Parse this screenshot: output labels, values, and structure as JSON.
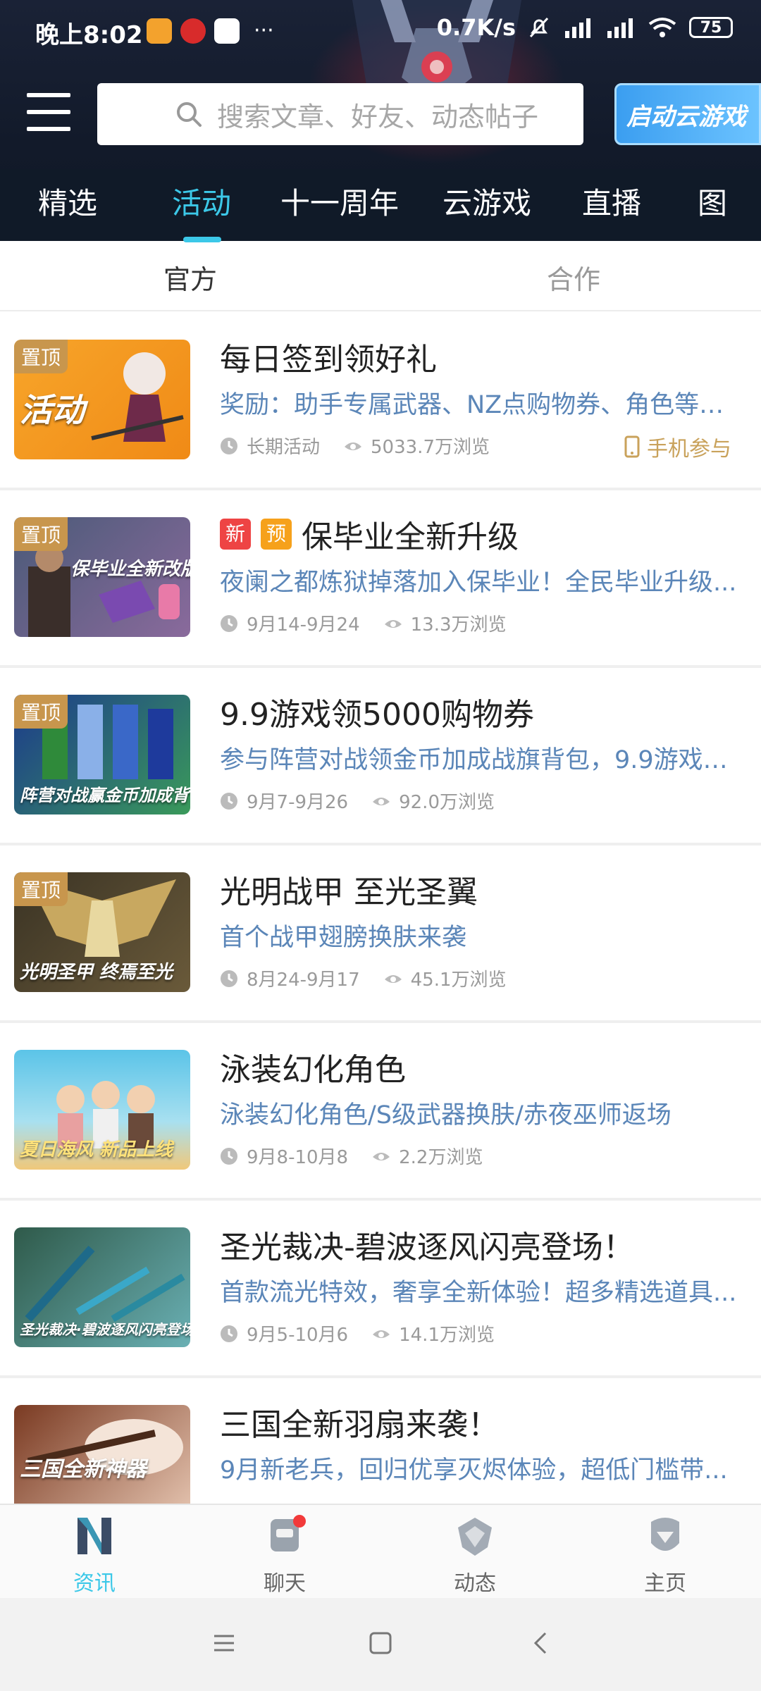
{
  "status_bar": {
    "time": "晚上8:02",
    "net_speed": "0.7K/s",
    "battery": "75"
  },
  "top_bar": {
    "search_placeholder": "搜索文章、好友、动态帖子",
    "cloud_game_button": "启动云游戏"
  },
  "tabs": [
    "精选",
    "活动",
    "十一周年",
    "云游戏",
    "直播",
    "图"
  ],
  "active_tab": "活动",
  "sub_tabs": {
    "official": "官方",
    "cooperation": "合作"
  },
  "activities": [
    {
      "title": "每日签到领好礼",
      "desc": "奖励：助手专属武器、NZ点购物券、角色等超...",
      "period": "长期活动",
      "views": "5033.7万浏览",
      "pinned_label": "置顶",
      "thumb_text": "活动",
      "join_label": "手机参与",
      "colors": [
        "#f7a52a",
        "#f08a16"
      ]
    },
    {
      "title": "保毕业全新升级",
      "desc": "夜阑之都炼狱掉落加入保毕业！全民毕业升级...",
      "period": "9月14-9月24",
      "views": "13.3万浏览",
      "pinned_label": "置顶",
      "tag_new": "新",
      "tag_pre": "预",
      "thumb_text": "保毕业全新改版升级!",
      "colors": [
        "#4a5a78",
        "#8a6a9c"
      ]
    },
    {
      "title": "9.9游戏领5000购物券",
      "desc": "参与阵营对战领金币加成战旗背包，9.9游戏领...",
      "period": "9月7-9月26",
      "views": "92.0万浏览",
      "pinned_label": "置顶",
      "thumb_text": "阵营对战赢金币加成背包",
      "colors": [
        "#1c3a8c",
        "#3a9a5a"
      ]
    },
    {
      "title": "光明战甲 至光圣翼",
      "desc": "首个战甲翅膀换肤来袭",
      "period": "8月24-9月17",
      "views": "45.1万浏览",
      "pinned_label": "置顶",
      "thumb_text": "光明圣甲 终焉至光",
      "colors": [
        "#3a3324",
        "#b8964a"
      ]
    },
    {
      "title": "泳装幻化角色",
      "desc": "泳装幻化角色/S级武器换肤/赤夜巫师返场",
      "period": "9月8-10月8",
      "views": "2.2万浏览",
      "thumb_text": "夏日海风 新品上线",
      "colors": [
        "#5bc4e8",
        "#f0c87a"
      ]
    },
    {
      "title": "圣光裁决-碧波逐风闪亮登场！",
      "desc": "首款流光特效，奢享全新体验！超多精选道具...",
      "period": "9月5-10月6",
      "views": "14.1万浏览",
      "thumb_text": "圣光裁决·碧波逐风闪亮登场!",
      "colors": [
        "#2f5a4a",
        "#6ab0b4"
      ]
    },
    {
      "title": "三国全新羽扇来袭！",
      "desc": "9月新老兵，回归优享灭烬体验，超低门槛带...",
      "period": "",
      "views": "",
      "thumb_text": "三国全新神器",
      "colors": [
        "#7a3a22",
        "#e8c8b4"
      ]
    }
  ],
  "bottom_nav": [
    {
      "label": "资讯",
      "active": true
    },
    {
      "label": "聊天",
      "active": false,
      "badge": true
    },
    {
      "label": "动态",
      "active": false
    },
    {
      "label": "主页",
      "active": false
    }
  ],
  "accent_color": "#3cc8e8"
}
